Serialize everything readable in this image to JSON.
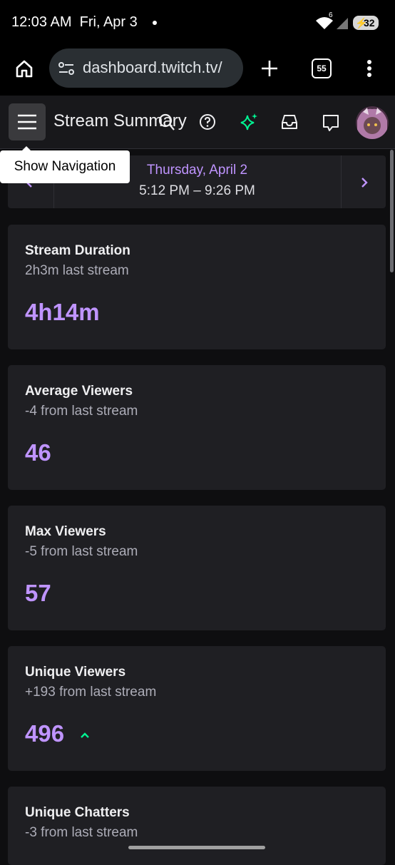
{
  "status_bar": {
    "time": "12:03 AM",
    "date": "Fri, Apr 3",
    "signal_label": "6",
    "battery": "32"
  },
  "browser": {
    "url": "dashboard.twitch.tv/",
    "tab_count": "55"
  },
  "header": {
    "title": "Stream Summary",
    "tooltip": "Show Navigation"
  },
  "date_selector": {
    "day": "Thursday, April 2",
    "time_range": "5:12 PM – 9:26 PM"
  },
  "cards": [
    {
      "title": "Stream Duration",
      "subtitle": "2h3m last stream",
      "value": "4h14m"
    },
    {
      "title": "Average Viewers",
      "subtitle": "-4 from last stream",
      "value": "46"
    },
    {
      "title": "Max Viewers",
      "subtitle": "-5 from last stream",
      "value": "57"
    },
    {
      "title": "Unique Viewers",
      "subtitle": "+193 from last stream",
      "value": "496",
      "trend": "up"
    },
    {
      "title": "Unique Chatters",
      "subtitle": "-3 from last stream",
      "value": ""
    }
  ],
  "colors": {
    "accent": "#bf94ff",
    "trend_up": "#00f593",
    "background": "#0e0e10",
    "card": "#1f1f23"
  }
}
